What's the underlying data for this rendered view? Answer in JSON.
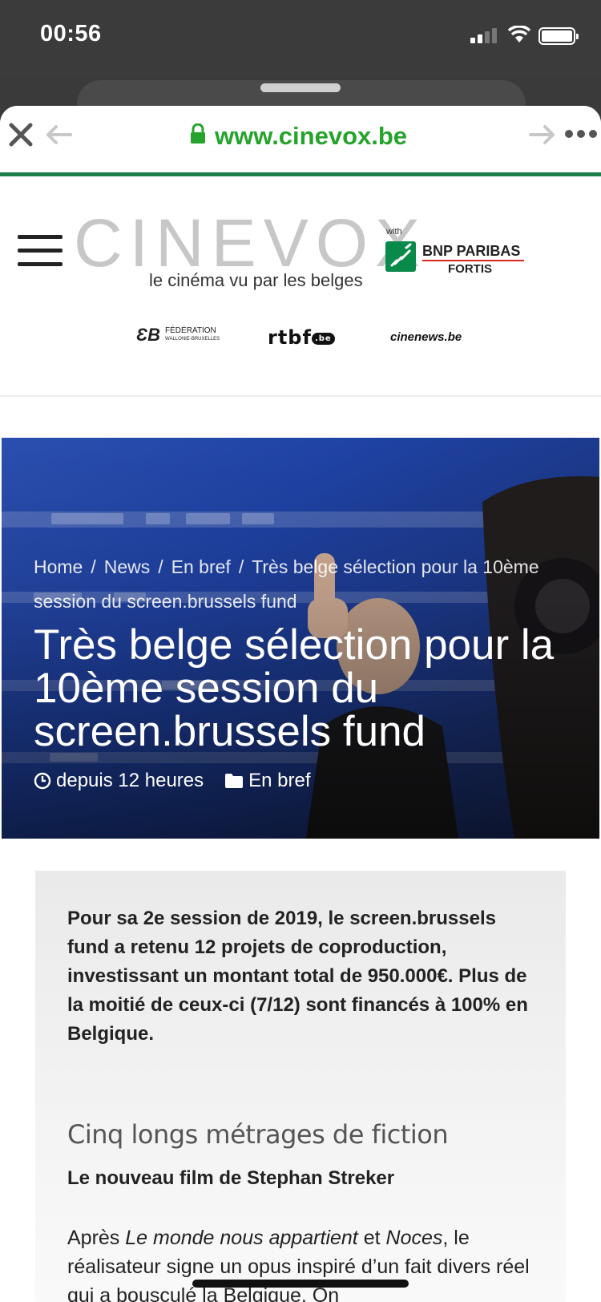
{
  "status": {
    "time": "00:56"
  },
  "browser": {
    "url": "www.cinevox.be"
  },
  "site": {
    "logo": "CINEVOX",
    "tagline": "le cinéma vu par les belges",
    "sponsor_with": "with",
    "sponsor_name": "BNP PARIBAS",
    "sponsor_sub": "FORTIS",
    "partners": {
      "federation_mark": "ƐB",
      "federation_title": "FÉDÉRATION",
      "federation_sub": "WALLONIE-BRUXELLES",
      "rtbf": "rtbf",
      "rtbf_suffix": ".be",
      "cinenews": "cinenews.be"
    }
  },
  "hero": {
    "breadcrumbs": [
      "Home",
      "News",
      "En bref",
      "Très belge sélection pour la 10ème session du screen.brussels fund"
    ],
    "title": "Très belge sélection pour la 10ème session du screen.brussels fund",
    "time": "depuis 12 heures",
    "category": "En bref"
  },
  "article": {
    "intro": "Pour sa 2e session de 2019, le screen.brussels fund a retenu 12 projets de coproduction, investissant un montant total de 950.000€. Plus de la moitié de ceux-ci (7/12) sont financés à  100% en Belgique.",
    "section_heading": "Cinq longs métrages de fiction",
    "subheading": "Le nouveau film de Stephan Streker",
    "para_a": "Après ",
    "para_title1": "Le monde nous appartient",
    "para_b": " et ",
    "para_title2": "Noces",
    "para_c": ", le réalisateur signe un opus inspiré d’un fait divers réel qui a bousculé la Belgique. On"
  },
  "colors": {
    "url_green": "#25a32b",
    "bar_green": "#1b7f4b",
    "hero_blue": "#1f43a6"
  }
}
